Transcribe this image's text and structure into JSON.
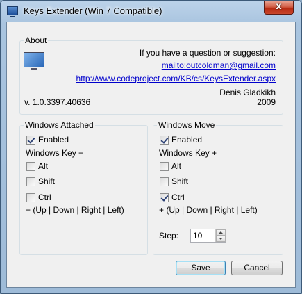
{
  "window": {
    "title": "Keys Extender (Win 7 Compatible)",
    "close_glyph": "x"
  },
  "about": {
    "group_label": "About",
    "question": "If you have a question or suggestion:",
    "email_link": "mailto:outcoldman@gmail.com",
    "url_link": "http://www.codeproject.com/KB/cs/KeysExtender.aspx",
    "author": "Denis Gladkikh",
    "year": "2009",
    "version": "v. 1.0.3397.40636"
  },
  "attached": {
    "group_label": "Windows Attached",
    "enabled_label": "Enabled",
    "enabled_checked": true,
    "key_label": "Windows Key +",
    "alt_label": "Alt",
    "alt_checked": false,
    "shift_label": "Shift",
    "shift_checked": false,
    "ctrl_label": "Ctrl",
    "ctrl_checked": false,
    "arrows_label": "+ (Up | Down | Right | Left)"
  },
  "move": {
    "group_label": "Windows Move",
    "enabled_label": "Enabled",
    "enabled_checked": true,
    "key_label": "Windows Key +",
    "alt_label": "Alt",
    "alt_checked": false,
    "shift_label": "Shift",
    "shift_checked": false,
    "ctrl_label": "Ctrl",
    "ctrl_checked": true,
    "arrows_label": "+ (Up | Down | Right | Left)",
    "step_label": "Step:",
    "step_value": "10"
  },
  "buttons": {
    "save_label": "Save",
    "cancel_label": "Cancel"
  },
  "icons": {
    "app": "monitor-icon",
    "about": "monitor-icon",
    "close": "close-icon"
  }
}
